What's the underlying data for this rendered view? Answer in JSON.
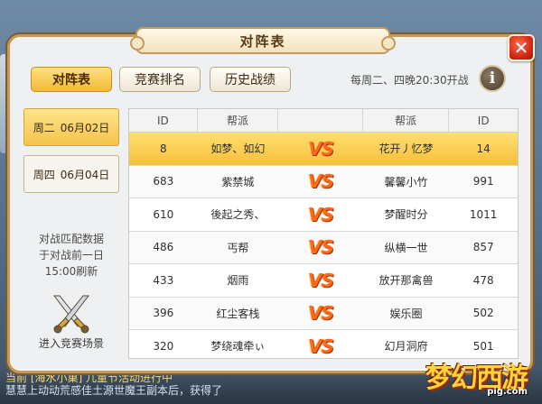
{
  "title": "对阵表",
  "close_icon": "close-icon",
  "tabs": [
    {
      "label": "对阵表",
      "active": true
    },
    {
      "label": "竞赛排名",
      "active": false
    },
    {
      "label": "历史战绩",
      "active": false
    }
  ],
  "schedule_text": "每周二、四晚20:30开战",
  "info_label": "i",
  "dates": [
    {
      "day": "周二",
      "date": "06月02日",
      "active": true
    },
    {
      "day": "周四",
      "date": "06月04日",
      "active": false
    }
  ],
  "side_note": [
    "对战匹配数据",
    "于对战前一日",
    "15:00刷新"
  ],
  "enter_scene_label": "进入竞赛场景",
  "table": {
    "headers": [
      "ID",
      "帮派",
      "",
      "帮派",
      "ID"
    ],
    "vs_label": "VS",
    "rows": [
      {
        "id1": "8",
        "guild1": "如梦、如幻",
        "guild2": "花开丿忆梦",
        "id2": "14",
        "highlight": true
      },
      {
        "id1": "683",
        "guild1": "紫禁城",
        "guild2": "馨馨小竹",
        "id2": "991"
      },
      {
        "id1": "610",
        "guild1": "後起之秀、",
        "guild2": "梦醒时分",
        "id2": "1011"
      },
      {
        "id1": "486",
        "guild1": "丐帮",
        "guild2": "纵横一世",
        "id2": "857"
      },
      {
        "id1": "433",
        "guild1": "烟雨",
        "guild2": "放开那禽兽",
        "id2": "478"
      },
      {
        "id1": "396",
        "guild1": "红尘客栈",
        "guild2": "娱乐圈",
        "id2": "502"
      },
      {
        "id1": "320",
        "guild1": "梦绕魂牵ぃ",
        "guild2": "幻月洞府",
        "id2": "501"
      }
    ]
  },
  "chat": {
    "line1": "当前  [海水小巢]  儿童节活动进行中",
    "line2": "慧慧上动动荒感佳土源世魔王副本后，获得了"
  },
  "logo": {
    "text": "梦幻西游",
    "sub": "pig.com"
  },
  "colors": {
    "accent": "#f2b93c",
    "panel_border": "#c49a5c",
    "vs": "#ff6a1a"
  }
}
